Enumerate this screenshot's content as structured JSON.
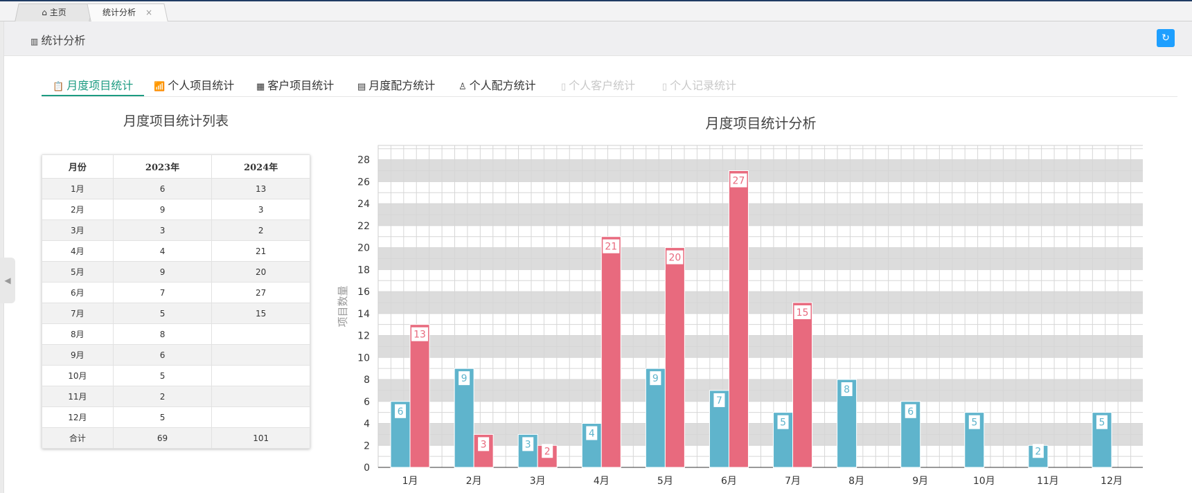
{
  "tabs": [
    {
      "label": "主页",
      "icon": "home-icon"
    },
    {
      "label": "统计分析",
      "icon": "close-icon",
      "close": "×"
    }
  ],
  "header": {
    "title": "统计分析",
    "icon": "bar-chart-icon",
    "refresh_icon": "refresh-icon"
  },
  "nav": [
    {
      "label": "月度项目统计",
      "icon": "clipboard-icon",
      "state": "active"
    },
    {
      "label": "个人项目统计",
      "icon": "chart-icon",
      "state": "normal"
    },
    {
      "label": "客户项目统计",
      "icon": "building-icon",
      "state": "normal"
    },
    {
      "label": "月度配方统计",
      "icon": "grid-icon",
      "state": "normal"
    },
    {
      "label": "个人配方统计",
      "icon": "user-icon",
      "state": "normal"
    },
    {
      "label": "个人客户统计",
      "icon": "file-icon",
      "state": "disabled"
    },
    {
      "label": "个人记录统计",
      "icon": "clipboard-icon",
      "state": "disabled"
    }
  ],
  "table": {
    "title": "月度项目统计列表",
    "headers": [
      "月份",
      "2023年",
      "2024年"
    ],
    "rows": [
      [
        "1月",
        "6",
        "13"
      ],
      [
        "2月",
        "9",
        "3"
      ],
      [
        "3月",
        "3",
        "2"
      ],
      [
        "4月",
        "4",
        "21"
      ],
      [
        "5月",
        "9",
        "20"
      ],
      [
        "6月",
        "7",
        "27"
      ],
      [
        "7月",
        "5",
        "15"
      ],
      [
        "8月",
        "8",
        ""
      ],
      [
        "9月",
        "6",
        ""
      ],
      [
        "10月",
        "5",
        ""
      ],
      [
        "11月",
        "2",
        ""
      ],
      [
        "12月",
        "5",
        ""
      ],
      [
        "合计",
        "69",
        "101"
      ]
    ]
  },
  "chart_data": {
    "type": "bar",
    "title": "月度项目统计分析",
    "ylabel": "项目数量",
    "xlabel": "",
    "categories": [
      "1月",
      "2月",
      "3月",
      "4月",
      "5月",
      "6月",
      "7月",
      "8月",
      "9月",
      "10月",
      "11月",
      "12月"
    ],
    "series": [
      {
        "values": [
          6,
          9,
          3,
          4,
          9,
          7,
          5,
          8,
          6,
          5,
          2,
          5
        ],
        "color": "#5fb4cc"
      },
      {
        "values": [
          13,
          3,
          2,
          21,
          20,
          27,
          15,
          null,
          null,
          null,
          null,
          null
        ],
        "color": "#e86a7e"
      }
    ],
    "ylim": [
      0,
      28
    ],
    "yticks": [
      0,
      2,
      4,
      6,
      8,
      10,
      12,
      14,
      16,
      18,
      20,
      22,
      24,
      26,
      28
    ],
    "grid": true,
    "band_color": "#dcdcdc"
  }
}
